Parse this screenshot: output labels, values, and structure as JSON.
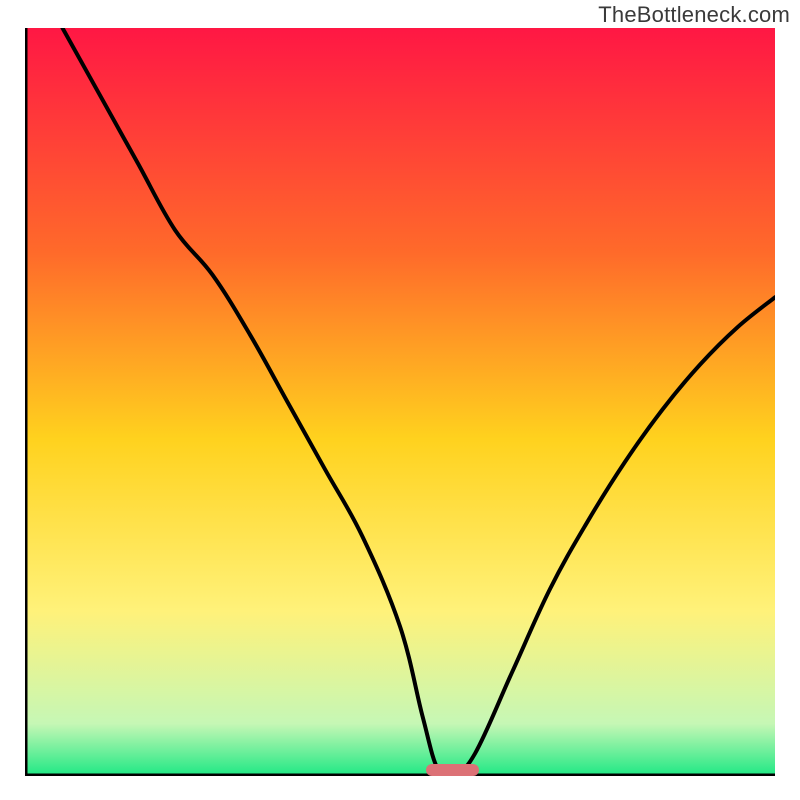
{
  "watermark": "TheBottleneck.com",
  "colors": {
    "gradient_top": "#ff1744",
    "gradient_mid1": "#ff6a2a",
    "gradient_mid2": "#ffd21e",
    "gradient_mid3": "#fff27a",
    "gradient_bottom_band": "#c6f7b5",
    "gradient_bottom": "#1ee884",
    "curve": "#000000",
    "axis": "#000000",
    "marker": "#dc7176"
  },
  "chart_data": {
    "type": "line",
    "title": "",
    "xlabel": "",
    "ylabel": "",
    "xlim": [
      0,
      100
    ],
    "ylim": [
      0,
      100
    ],
    "curve": {
      "x": [
        5,
        10,
        15,
        20,
        25,
        30,
        35,
        40,
        45,
        50,
        53,
        55,
        57,
        60,
        65,
        70,
        75,
        80,
        85,
        90,
        95,
        100
      ],
      "y": [
        100,
        91,
        82,
        73,
        67,
        59,
        50,
        41,
        32,
        20,
        8,
        1,
        0,
        3,
        14,
        25,
        34,
        42,
        49,
        55,
        60,
        64
      ]
    },
    "marker": {
      "x_start": 53.5,
      "x_end": 60.5,
      "y": 0.8
    },
    "annotations": []
  }
}
